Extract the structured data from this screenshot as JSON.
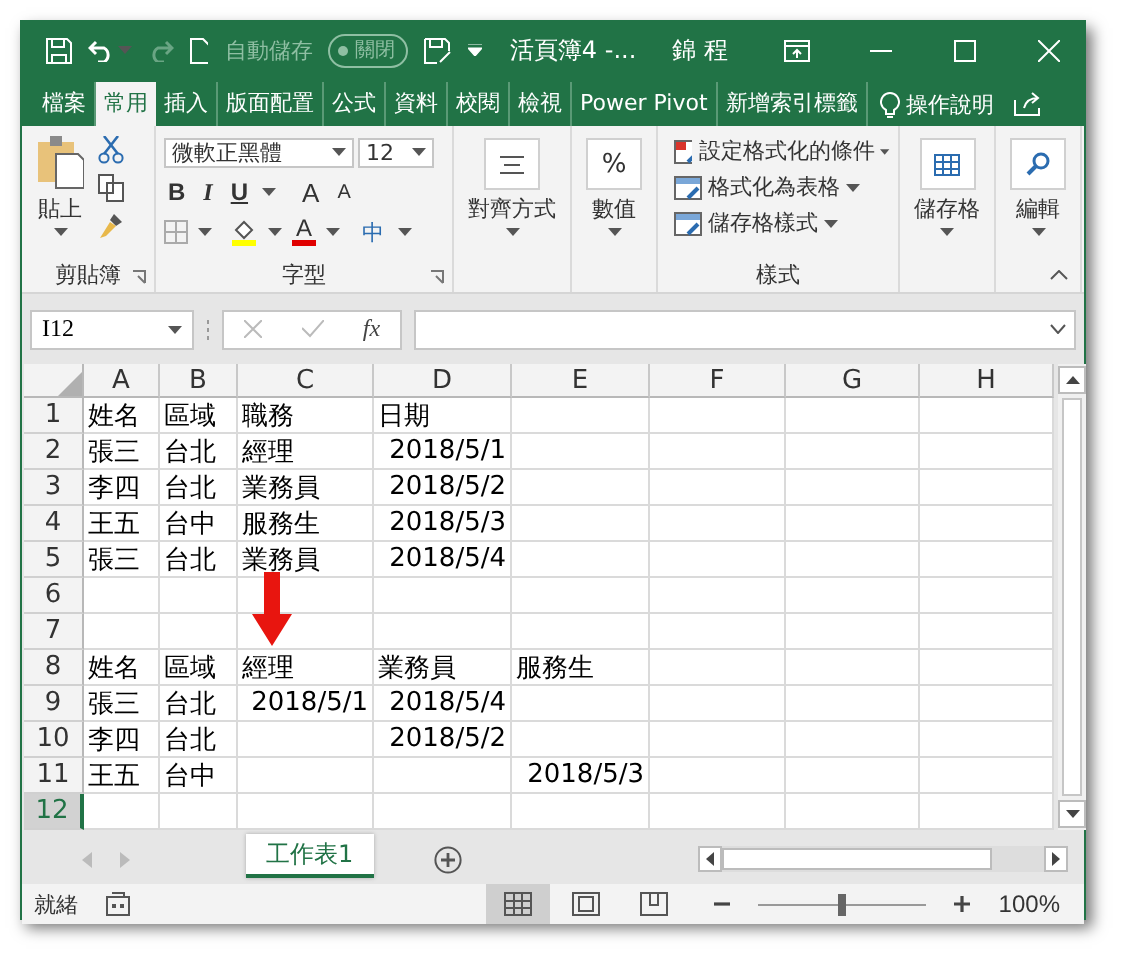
{
  "title_bar": {
    "autosave": {
      "label": "自動儲存",
      "state": "關閉",
      "on": false
    },
    "title": "活頁簿4 -...",
    "user": "錦 程"
  },
  "ribbon_tabs": [
    {
      "label": "檔案",
      "selected": false
    },
    {
      "label": "常用",
      "selected": true
    },
    {
      "label": "插入",
      "selected": false
    },
    {
      "label": "版面配置",
      "selected": false
    },
    {
      "label": "公式",
      "selected": false
    },
    {
      "label": "資料",
      "selected": false
    },
    {
      "label": "校閱",
      "selected": false
    },
    {
      "label": "檢視",
      "selected": false
    },
    {
      "label": "Power Pivot",
      "selected": false
    },
    {
      "label": "新增索引標籤",
      "selected": false
    }
  ],
  "tell_me": "操作說明",
  "clipboard": {
    "paste": "貼上",
    "label": "剪貼簿"
  },
  "font": {
    "name": "微軟正黑體",
    "size": "12",
    "bold": "B",
    "italic": "I",
    "underline": "U",
    "grow": "A",
    "shrink": "A",
    "font_color": "A",
    "phonetic": "中",
    "label": "字型"
  },
  "alignment": {
    "label": "對齊方式"
  },
  "number": {
    "symbol": "%",
    "label": "數值"
  },
  "styles": {
    "items": [
      "設定格式化的條件",
      "格式化為表格",
      "儲存格樣式"
    ],
    "label": "樣式"
  },
  "cells_group": {
    "label": "儲存格"
  },
  "editing": {
    "label": "編輯"
  },
  "formula_bar": {
    "name_box": "I12",
    "function_symbol": "fx"
  },
  "sheet": {
    "columns": [
      "A",
      "B",
      "C",
      "D",
      "E",
      "F",
      "G",
      "H"
    ],
    "rows": [
      {
        "number": "1",
        "selected": false,
        "cells": [
          {
            "text": "姓名",
            "kind": "text"
          },
          {
            "text": "區域",
            "kind": "text"
          },
          {
            "text": "職務",
            "kind": "text"
          },
          {
            "text": "日期",
            "kind": "text"
          }
        ]
      },
      {
        "number": "2",
        "selected": false,
        "cells": [
          {
            "text": "張三",
            "kind": "text"
          },
          {
            "text": "台北",
            "kind": "text"
          },
          {
            "text": "經理",
            "kind": "text"
          },
          {
            "text": "2018/5/1",
            "kind": "date"
          }
        ]
      },
      {
        "number": "3",
        "selected": false,
        "cells": [
          {
            "text": "李四",
            "kind": "text"
          },
          {
            "text": "台北",
            "kind": "text"
          },
          {
            "text": "業務員",
            "kind": "text"
          },
          {
            "text": "2018/5/2",
            "kind": "date"
          }
        ]
      },
      {
        "number": "4",
        "selected": false,
        "cells": [
          {
            "text": "王五",
            "kind": "text"
          },
          {
            "text": "台中",
            "kind": "text"
          },
          {
            "text": "服務生",
            "kind": "text"
          },
          {
            "text": "2018/5/3",
            "kind": "date"
          }
        ]
      },
      {
        "number": "5",
        "selected": false,
        "cells": [
          {
            "text": "張三",
            "kind": "text"
          },
          {
            "text": "台北",
            "kind": "text"
          },
          {
            "text": "業務員",
            "kind": "text"
          },
          {
            "text": "2018/5/4",
            "kind": "date"
          }
        ]
      },
      {
        "number": "6",
        "selected": false,
        "cells": []
      },
      {
        "number": "7",
        "selected": false,
        "cells": []
      },
      {
        "number": "8",
        "selected": false,
        "cells": [
          {
            "text": "姓名",
            "kind": "text"
          },
          {
            "text": "區域",
            "kind": "text"
          },
          {
            "text": "經理",
            "kind": "text"
          },
          {
            "text": "業務員",
            "kind": "text"
          },
          {
            "text": "服務生",
            "kind": "text"
          }
        ]
      },
      {
        "number": "9",
        "selected": false,
        "cells": [
          {
            "text": "張三",
            "kind": "text"
          },
          {
            "text": "台北",
            "kind": "text"
          },
          {
            "text": "2018/5/1",
            "kind": "date"
          },
          {
            "text": "2018/5/4",
            "kind": "date"
          }
        ]
      },
      {
        "number": "10",
        "selected": false,
        "cells": [
          {
            "text": "李四",
            "kind": "text"
          },
          {
            "text": "台北",
            "kind": "text"
          },
          {
            "kind": "empty"
          },
          {
            "text": "2018/5/2",
            "kind": "date"
          }
        ]
      },
      {
        "number": "11",
        "selected": false,
        "cells": [
          {
            "text": "王五",
            "kind": "text"
          },
          {
            "text": "台中",
            "kind": "text"
          },
          {
            "kind": "empty"
          },
          {
            "kind": "empty"
          },
          {
            "text": "2018/5/3",
            "kind": "date"
          }
        ]
      },
      {
        "number": "12",
        "selected": true,
        "cells": []
      }
    ]
  },
  "sheet_tabs": [
    {
      "label": "工作表1",
      "selected": true
    }
  ],
  "status_bar": {
    "status": "就緒",
    "views": [
      {
        "kind": "normal",
        "selected": true
      },
      {
        "kind": "page_layout",
        "selected": false
      },
      {
        "kind": "page_break",
        "selected": false
      }
    ],
    "zoom_slider": {
      "level": 0.5
    },
    "zoom": "100%"
  }
}
